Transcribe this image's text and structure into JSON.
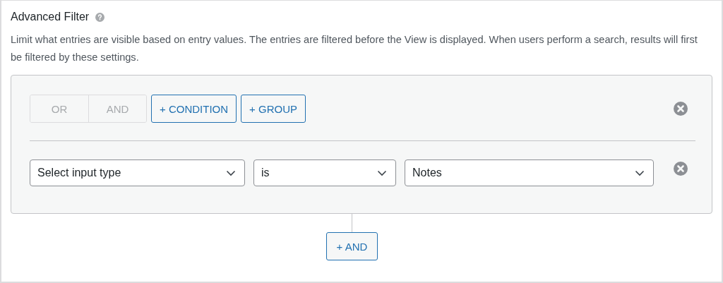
{
  "section": {
    "title": "Advanced Filter",
    "description": "Limit what entries are visible based on entry values. The entries are filtered before the View is displayed. When users perform a search, results will first be filtered by these settings."
  },
  "group": {
    "toggle": [
      {
        "label": "OR",
        "disabled": true
      },
      {
        "label": "AND",
        "disabled": true
      }
    ],
    "buttons": [
      {
        "label": "+ CONDITION"
      },
      {
        "label": "+ GROUP"
      }
    ],
    "conditions": [
      {
        "selects": [
          {
            "value": "Select input type"
          },
          {
            "value": "is"
          },
          {
            "value": "Notes"
          }
        ]
      }
    ]
  },
  "add_button": {
    "label": "+ AND"
  }
}
